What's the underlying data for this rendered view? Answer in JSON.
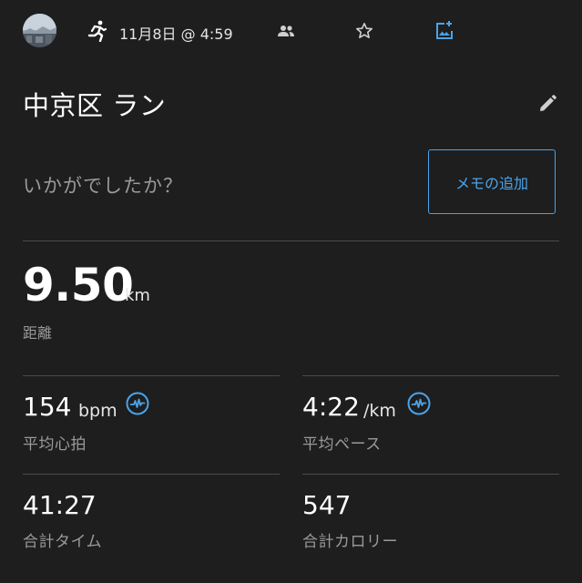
{
  "header": {
    "avatar_icon": "profile-photo",
    "activity_icon": "running-icon",
    "date_time": "11月8日 @ 4:59",
    "people_icon": "people-icon",
    "star_icon": "star-outline-icon",
    "photo_icon": "add-photo-icon"
  },
  "activity": {
    "title": "中京区 ラン",
    "edit_icon": "pencil-icon"
  },
  "feedback": {
    "prompt": "いかがでしたか？",
    "memo_button": "メモの追加"
  },
  "distance": {
    "value": "9.50",
    "unit": "km",
    "label": "距離"
  },
  "stats": [
    {
      "value": "154",
      "unit": "bpm",
      "label": "平均心拍",
      "icon": "heart-rate-zone-icon"
    },
    {
      "value": "4:22",
      "unit": "/km",
      "label": "平均ペース",
      "icon": "pace-zone-icon"
    },
    {
      "value": "41:27",
      "unit": "",
      "label": "合計タイム"
    },
    {
      "value": "547",
      "unit": "",
      "label": "合計カロリー"
    }
  ],
  "colors": {
    "background": "#1e1e1e",
    "accent": "#4aa3ea",
    "secondary_text": "#9a9a9a",
    "divider": "#4a4a4a"
  }
}
